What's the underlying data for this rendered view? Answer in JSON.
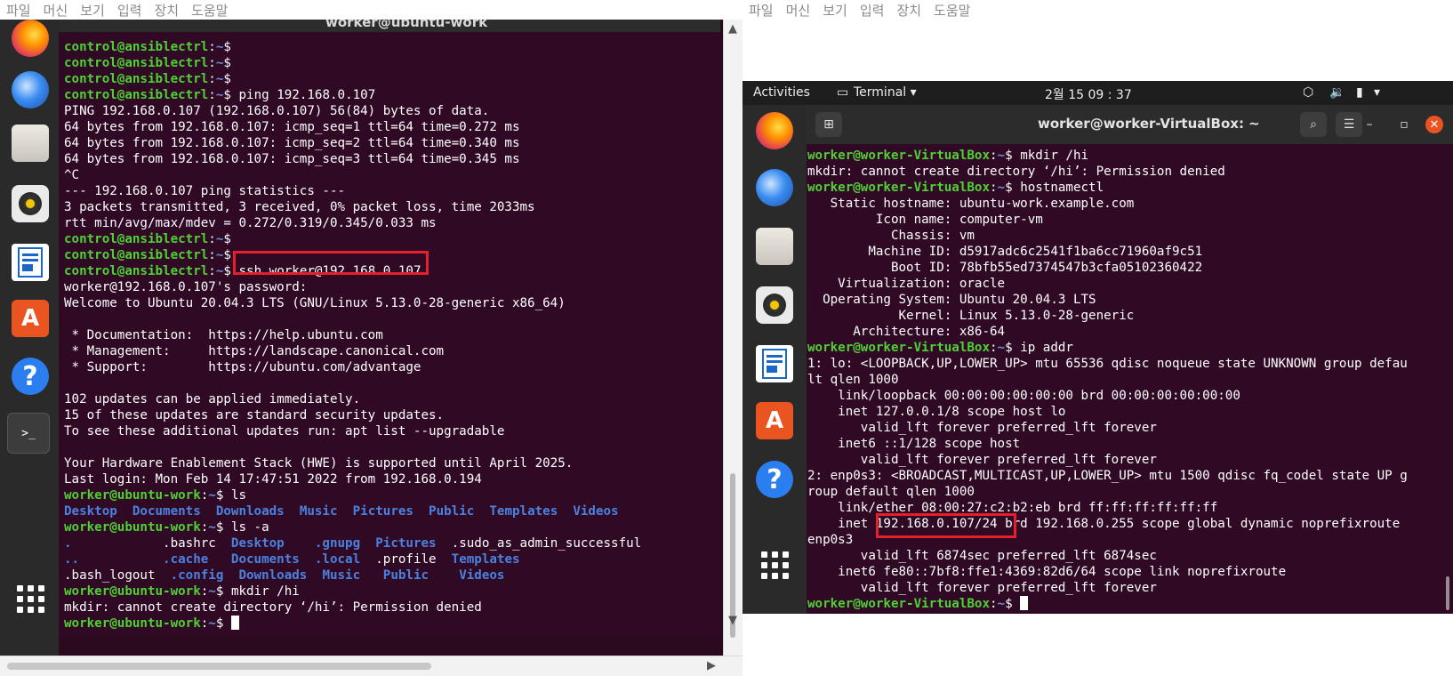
{
  "vbox_menu": [
    "파일",
    "머신",
    "보기",
    "입력",
    "장치",
    "도움말"
  ],
  "left": {
    "window_title": "worker@ubuntu-work",
    "dock": [
      "firefox-icon",
      "thunderbird-icon",
      "files-icon",
      "rhythmbox-icon",
      "writer-icon",
      "software-icon",
      "help-icon",
      "terminal-icon",
      "apps-grid-icon"
    ],
    "lines": [
      {
        "p": [
          "control@ansiblectrl",
          "~",
          "$ "
        ]
      },
      {
        "p": [
          "control@ansiblectrl",
          "~",
          "$ "
        ]
      },
      {
        "p": [
          "control@ansiblectrl",
          "~",
          "$ "
        ]
      },
      {
        "p": [
          "control@ansiblectrl",
          "~",
          "$ "
        ],
        "t": "ping 192.168.0.107"
      },
      {
        "t": "PING 192.168.0.107 (192.168.0.107) 56(84) bytes of data."
      },
      {
        "t": "64 bytes from 192.168.0.107: icmp_seq=1 ttl=64 time=0.272 ms"
      },
      {
        "t": "64 bytes from 192.168.0.107: icmp_seq=2 ttl=64 time=0.340 ms"
      },
      {
        "t": "64 bytes from 192.168.0.107: icmp_seq=3 ttl=64 time=0.345 ms"
      },
      {
        "t": "^C"
      },
      {
        "t": "--- 192.168.0.107 ping statistics ---"
      },
      {
        "t": "3 packets transmitted, 3 received, 0% packet loss, time 2033ms"
      },
      {
        "t": "rtt min/avg/max/mdev = 0.272/0.319/0.345/0.033 ms"
      },
      {
        "p": [
          "control@ansiblectrl",
          "~",
          "$ "
        ]
      },
      {
        "p": [
          "control@ansiblectrl",
          "~",
          "$ "
        ]
      },
      {
        "p": [
          "control@ansiblectrl",
          "~",
          "$ "
        ],
        "t": "ssh worker@192.168.0.107"
      },
      {
        "t": "worker@192.168.0.107's password:"
      },
      {
        "t": "Welcome to Ubuntu 20.04.3 LTS (GNU/Linux 5.13.0-28-generic x86_64)"
      },
      {
        "t": ""
      },
      {
        "t": " * Documentation:  https://help.ubuntu.com"
      },
      {
        "t": " * Management:     https://landscape.canonical.com"
      },
      {
        "t": " * Support:        https://ubuntu.com/advantage"
      },
      {
        "t": ""
      },
      {
        "t": "102 updates can be applied immediately."
      },
      {
        "t": "15 of these updates are standard security updates."
      },
      {
        "t": "To see these additional updates run: apt list --upgradable"
      },
      {
        "t": ""
      },
      {
        "t": "Your Hardware Enablement Stack (HWE) is supported until April 2025."
      },
      {
        "t": "Last login: Mon Feb 14 17:47:51 2022 from 192.168.0.194"
      },
      {
        "p": [
          "worker@ubuntu-work",
          "~",
          "$ "
        ],
        "t": "ls"
      },
      {
        "dirs": [
          "Desktop  ",
          "Documents  ",
          "Downloads  ",
          "Music  ",
          "Pictures  ",
          "Public  ",
          "Templates  ",
          "Videos"
        ]
      },
      {
        "p": [
          "worker@ubuntu-work",
          "~",
          "$ "
        ],
        "t": "ls -a"
      },
      {
        "mix": [
          [
            "d",
            ".            "
          ],
          [
            "t",
            ".bashrc  "
          ],
          [
            "d",
            "Desktop    "
          ],
          [
            "d",
            ".gnupg  "
          ],
          [
            "d",
            "Pictures  "
          ],
          [
            "t",
            ".sudo_as_admin_successful"
          ]
        ]
      },
      {
        "mix": [
          [
            "d",
            "..           "
          ],
          [
            "d",
            ".cache   "
          ],
          [
            "d",
            "Documents  "
          ],
          [
            "d",
            ".local  "
          ],
          [
            "t",
            ".profile  "
          ],
          [
            "d",
            "Templates"
          ]
        ]
      },
      {
        "mix": [
          [
            "t",
            ".bash_logout  "
          ],
          [
            "d",
            ".config  "
          ],
          [
            "d",
            "Downloads  "
          ],
          [
            "d",
            "Music   "
          ],
          [
            "d",
            "Public    "
          ],
          [
            "d",
            "Videos"
          ]
        ]
      },
      {
        "p": [
          "worker@ubuntu-work",
          "~",
          "$ "
        ],
        "t": "mkdir /hi"
      },
      {
        "t": "mkdir: cannot create directory ‘/hi’: Permission denied"
      },
      {
        "p": [
          "worker@ubuntu-work",
          "~",
          "$ "
        ],
        "cursor": true
      }
    ]
  },
  "right": {
    "topbar": {
      "activities": "Activities",
      "app": "Terminal ▾",
      "clock": "2월 15  09 : 37"
    },
    "window_title": "worker@worker-VirtualBox: ~",
    "dock": [
      "firefox-icon",
      "thunderbird-icon",
      "files-icon",
      "rhythmbox-icon",
      "writer-icon",
      "software-icon",
      "help-icon",
      "apps-grid-icon"
    ],
    "lines": [
      {
        "p": [
          "worker@worker-VirtualBox",
          "~",
          "$ "
        ],
        "t": "mkdir /hi"
      },
      {
        "t": "mkdir: cannot create directory ‘/hi’: Permission denied"
      },
      {
        "p": [
          "worker@worker-VirtualBox",
          "~",
          "$ "
        ],
        "t": "hostnamectl"
      },
      {
        "t": "   Static hostname: ubuntu-work.example.com"
      },
      {
        "t": "         Icon name: computer-vm"
      },
      {
        "t": "           Chassis: vm"
      },
      {
        "t": "        Machine ID: d5917adc6c2541f1ba6cc71960af9c51"
      },
      {
        "t": "           Boot ID: 78bfb55ed7374547b3cfa05102360422"
      },
      {
        "t": "    Virtualization: oracle"
      },
      {
        "t": "  Operating System: Ubuntu 20.04.3 LTS"
      },
      {
        "t": "            Kernel: Linux 5.13.0-28-generic"
      },
      {
        "t": "      Architecture: x86-64"
      },
      {
        "p": [
          "worker@worker-VirtualBox",
          "~",
          "$ "
        ],
        "t": "ip addr"
      },
      {
        "t": "1: lo: <LOOPBACK,UP,LOWER_UP> mtu 65536 qdisc noqueue state UNKNOWN group defau"
      },
      {
        "t": "lt qlen 1000"
      },
      {
        "t": "    link/loopback 00:00:00:00:00:00 brd 00:00:00:00:00:00"
      },
      {
        "t": "    inet 127.0.0.1/8 scope host lo"
      },
      {
        "t": "       valid_lft forever preferred_lft forever"
      },
      {
        "t": "    inet6 ::1/128 scope host"
      },
      {
        "t": "       valid_lft forever preferred_lft forever"
      },
      {
        "t": "2: enp0s3: <BROADCAST,MULTICAST,UP,LOWER_UP> mtu 1500 qdisc fq_codel state UP g"
      },
      {
        "t": "roup default qlen 1000"
      },
      {
        "t": "    link/ether 08:00:27:c2:b2:eb brd ff:ff:ff:ff:ff:ff"
      },
      {
        "t": "    inet 192.168.0.107/24 brd 192.168.0.255 scope global dynamic noprefixroute"
      },
      {
        "t": "enp0s3"
      },
      {
        "t": "       valid_lft 6874sec preferred_lft 6874sec"
      },
      {
        "t": "    inet6 fe80::7bf8:ffe1:4369:82d6/64 scope link noprefixroute"
      },
      {
        "t": "       valid_lft forever preferred_lft forever"
      },
      {
        "p": [
          "worker@worker-VirtualBox",
          "~",
          "$ "
        ],
        "cursor": true
      }
    ]
  },
  "highlights": {
    "ssh_command": "ssh worker@192.168.0.107",
    "ip_address": "192.168.0.107/24"
  },
  "colors": {
    "term_bg": "#300a24",
    "prompt_user": "#4fd135",
    "prompt_path": "#6c8fd9",
    "dir": "#4b82e0",
    "highlight_box": "#e6202a",
    "ubuntu_orange": "#e95420"
  }
}
